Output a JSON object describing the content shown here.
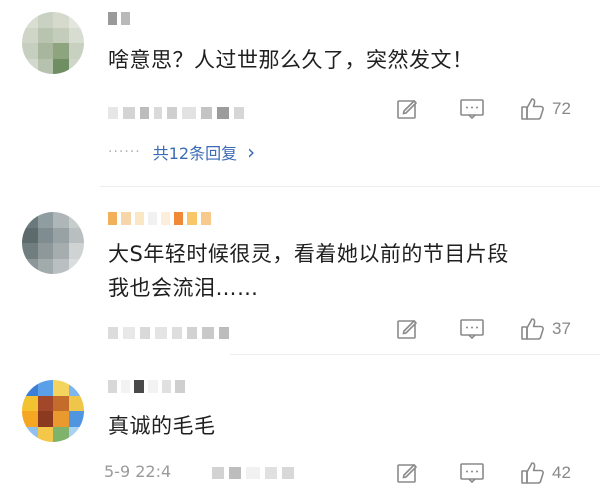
{
  "comments": [
    {
      "text": "啥意思？人过世那么久了，突然发文！",
      "time": "",
      "likes": "72",
      "replies_label": "共12条回复",
      "replies_chevron": "›"
    },
    {
      "text_line1": "大S年轻时候很灵，看着她以前的节目片段",
      "text_line2": "我也会流泪……",
      "time": "",
      "likes": "37"
    },
    {
      "text": "真诚的毛毛",
      "time": "5-9 22:4",
      "likes": "42"
    }
  ],
  "icons": {
    "edit": "edit-icon",
    "comment": "comment-icon",
    "like": "thumbs-up-icon"
  },
  "colors": {
    "link": "#3b6bb5",
    "meta": "#9a9a9a",
    "icon": "#8a8a8a",
    "divider": "#ececec"
  }
}
